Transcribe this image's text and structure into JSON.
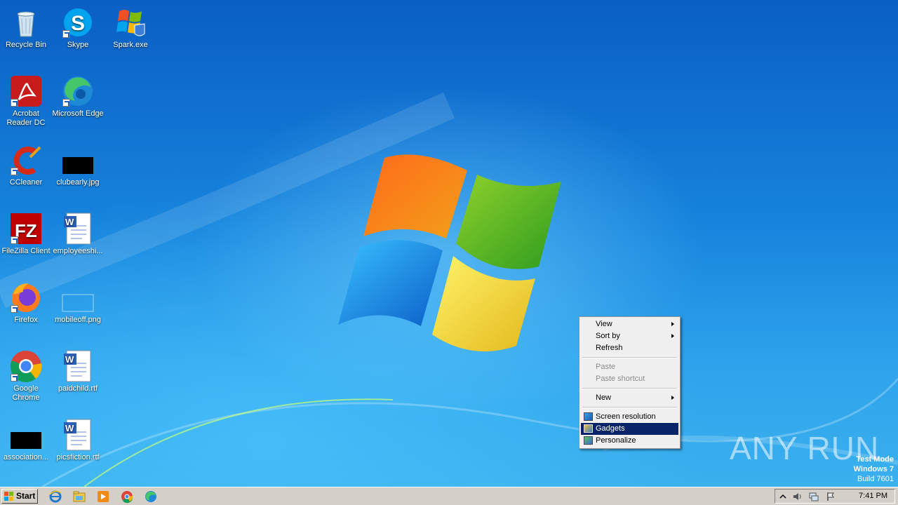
{
  "desktop": {
    "icons": [
      {
        "label": "Recycle Bin",
        "icon": "recycle-bin-icon"
      },
      {
        "label": "Skype",
        "icon": "skype-icon"
      },
      {
        "label": "Spark.exe",
        "icon": "windows-flag-icon"
      },
      {
        "label": "Acrobat Reader DC",
        "icon": "acrobat-icon"
      },
      {
        "label": "Microsoft Edge",
        "icon": "edge-icon"
      },
      {
        "label": "CCleaner",
        "icon": "ccleaner-icon"
      },
      {
        "label": "clubearly.jpg",
        "icon": "image-file-icon"
      },
      {
        "label": "FileZilla Client",
        "icon": "filezilla-icon"
      },
      {
        "label": "employeeshi...",
        "icon": "word-doc-icon"
      },
      {
        "label": "Firefox",
        "icon": "firefox-icon"
      },
      {
        "label": "mobileoff.png",
        "icon": "image-file-icon"
      },
      {
        "label": "Google Chrome",
        "icon": "chrome-icon"
      },
      {
        "label": "paidchild.rtf",
        "icon": "word-doc-icon"
      },
      {
        "label": "association...",
        "icon": "image-file-icon"
      },
      {
        "label": "picsfiction.rtf",
        "icon": "word-doc-icon"
      }
    ]
  },
  "context_menu": {
    "items": [
      {
        "label": "View",
        "submenu": true
      },
      {
        "label": "Sort by",
        "submenu": true
      },
      {
        "label": "Refresh"
      },
      {
        "label": "Paste",
        "disabled": true
      },
      {
        "label": "Paste shortcut",
        "disabled": true
      },
      {
        "label": "New",
        "submenu": true
      },
      {
        "label": "Screen resolution"
      },
      {
        "label": "Gadgets",
        "selected": true
      },
      {
        "label": "Personalize"
      }
    ]
  },
  "taskbar": {
    "start_label": "Start",
    "quick_launch": [
      "internet-explorer-icon",
      "explorer-folder-icon",
      "media-player-icon",
      "chrome-icon",
      "edge-icon"
    ],
    "tray_icons": [
      "show-hidden-icons-icon",
      "volume-icon",
      "network-icon",
      "action-center-flag-icon"
    ],
    "clock": "7:41 PM"
  },
  "watermark": "ANY RUN",
  "test_mode": {
    "line1": "Test Mode",
    "line2": "Windows 7",
    "line3": "Build 7601"
  },
  "colors": {
    "menu_highlight": "#0a246a",
    "taskbar": "#d4d0c8",
    "desktop_blue": "#1683dc"
  }
}
